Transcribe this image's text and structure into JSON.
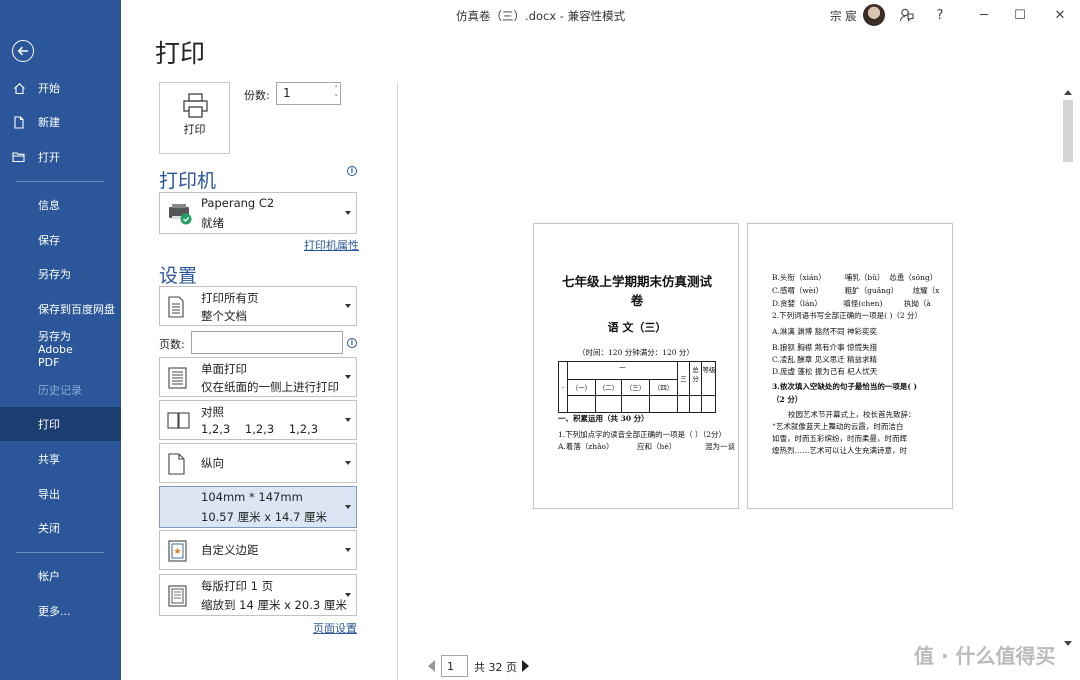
{
  "window": {
    "title": "仿真卷（三）.docx  -  兼容性模式",
    "user": "宗 宸",
    "buttons": {
      "help": "?",
      "minimize": "─",
      "restore": "☐",
      "close": "✕"
    }
  },
  "sidebar": {
    "items": [
      {
        "label": "开始",
        "icon": "home-icon"
      },
      {
        "label": "新建",
        "icon": "new-document-icon"
      },
      {
        "label": "打开",
        "icon": "open-folder-icon"
      },
      {
        "label": "信息"
      },
      {
        "label": "保存"
      },
      {
        "label": "另存为"
      },
      {
        "label": "保存到百度网盘"
      },
      {
        "label": "另存为 Adobe PDF"
      },
      {
        "label": "历史记录",
        "state": "disabled"
      },
      {
        "label": "打印",
        "state": "active"
      },
      {
        "label": "共享"
      },
      {
        "label": "导出"
      },
      {
        "label": "关闭"
      },
      {
        "label": "帐户"
      },
      {
        "label": "更多..."
      }
    ]
  },
  "main": {
    "heading": "打印",
    "print_button": "打印",
    "copies_label": "份数:",
    "copies_value": "1",
    "printer_section": "打印机",
    "printer": {
      "name": "Paperang C2",
      "status": "就绪"
    },
    "printer_properties_link": "打印机属性",
    "settings_section": "设置",
    "settings": [
      {
        "line1": "打印所有页",
        "line2": "整个文档"
      },
      {
        "line1": "单面打印",
        "line2": "仅在纸面的一侧上进行打印"
      },
      {
        "line1": "对照",
        "line2": "1,2,3    1,2,3    1,2,3"
      },
      {
        "line1": "纵向"
      },
      {
        "line1": "104mm * 147mm",
        "line2": "10.57 厘米 x 14.7 厘米"
      },
      {
        "line1": "自定义边距"
      },
      {
        "line1": "每版打印 1 页",
        "line2": "缩放到 14 厘米 x 20.3 厘米"
      }
    ],
    "pages_label": "页数:",
    "pages_value": "",
    "page_setup_link": "页面设置"
  },
  "preview": {
    "page1": {
      "title_line1": "七年级上学期期末仿真测试",
      "title_line2": "卷",
      "subject": "语 文（三）",
      "time_note": "（时间：120 分钟满分：120 分）",
      "table_headers": [
        "一",
        "二",
        "三",
        "总分",
        "等级"
      ],
      "table_subheaders": [
        "（一）",
        "（二）",
        "（三）",
        "（四）"
      ],
      "section": "一、积累运用（共 30 分）",
      "q1": "1.下列加点字的读音全部正确的一项是（  ）（2分）",
      "q1_options": [
        "A.着落（zhǎo）",
        "应和（hè）",
        "混为一谈"
      ]
    },
    "page2": {
      "lines": [
        "B.头衔（xián）        哺乳（bǔ）  怂恿（sǒng）",
        "C.感喟（wèi）         粗犷（guǎng）      炫耀（x",
        "D.贪婪（lán）         嗔怪(chen)         执拗（à",
        "2.下列词语书写全部正确的一项是(   )（2 分）",
        "A.淋漓 渊博 豁然不同 神彩奕奕",
        "B.狼狈 胸襟 煞有介事 惊慌失措",
        "C.凌乱 酬章 见义思迁 精益求精",
        "D.庞虚 蓬松 振为己有 杞人忧天"
      ],
      "q3": "3.依次填入空缺处的句子最恰当的一项是(   )",
      "q3_score": "（2 分）",
      "para": [
        "校园艺术节开幕式上，校长首先致辞：",
        "“艺术就像蓝天上舞动的云霞，时而洁白",
        "如雪，时而五彩缤纷，时而柔曼，时而辉",
        "煌热烈……艺术可以让人生充满诗意，时"
      ]
    }
  },
  "pager": {
    "current": "1",
    "total": "共 32 页"
  },
  "watermark": "值 · 什么值得买",
  "colors": {
    "sidebar": "#2b579a",
    "sidebar_active": "#1c3d70",
    "accent": "#2b579a"
  }
}
